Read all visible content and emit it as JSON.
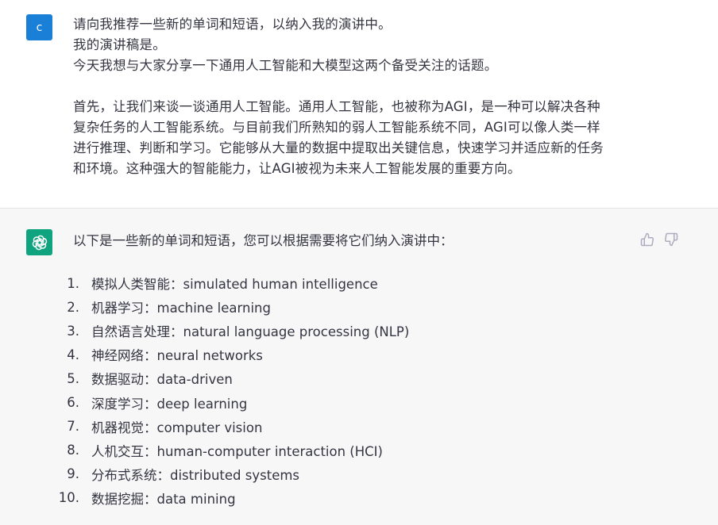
{
  "user": {
    "avatar_letter": "c",
    "avatar_color": "#1a7fd6",
    "lines_1": [
      "请向我推荐一些新的单词和短语，以纳入我的演讲中。",
      "我的演讲稿是。",
      "今天我想与大家分享一下通用人工智能和大模型这两个备受关注的话题。"
    ],
    "lines_2": [
      "首先，让我们来谈一谈通用人工智能。通用人工智能，也被称为AGI，是一种可以解决各种",
      "复杂任务的人工智能系统。与目前我们所熟知的弱人工智能系统不同，AGI可以像人类一样",
      "进行推理、判断和学习。它能够从大量的数据中提取出关键信息，快速学习并适应新的任务",
      "和环境。这种强大的智能能力，让AGI被视为未来人工智能发展的重要方向。"
    ]
  },
  "assistant": {
    "avatar_icon": "openai-logo-icon",
    "avatar_color": "#10a37f",
    "intro": "以下是一些新的单词和短语，您可以根据需要将它们纳入演讲中：",
    "items": [
      {
        "num": "1.",
        "text": "模拟人类智能：simulated human intelligence"
      },
      {
        "num": "2.",
        "text": "机器学习：machine learning"
      },
      {
        "num": "3.",
        "text": "自然语言处理：natural language processing (NLP)"
      },
      {
        "num": "4.",
        "text": "神经网络：neural networks"
      },
      {
        "num": "5.",
        "text": "数据驱动：data-driven"
      },
      {
        "num": "6.",
        "text": "深度学习：deep learning"
      },
      {
        "num": "7.",
        "text": "机器视觉：computer vision"
      },
      {
        "num": "8.",
        "text": "人机交互：human-computer interaction (HCI)"
      },
      {
        "num": "9.",
        "text": "分布式系统：distributed systems"
      },
      {
        "num": "10.",
        "text": "数据挖掘：data mining"
      }
    ]
  },
  "feedback": {
    "up_icon": "thumbs-up-icon",
    "down_icon": "thumbs-down-icon"
  }
}
